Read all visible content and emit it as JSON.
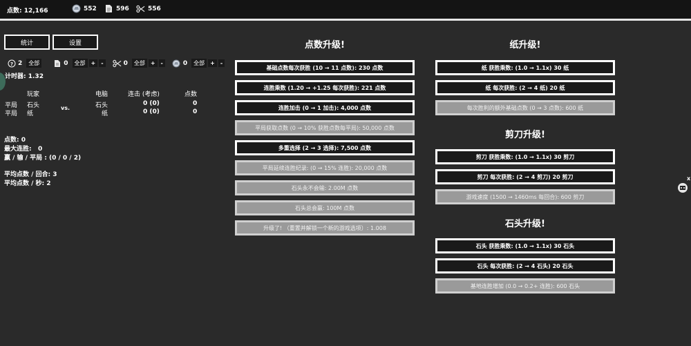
{
  "topbar": {
    "points_label": "点数: 12,166",
    "rock_count": "552",
    "paper_count": "596",
    "scissors_count": "556"
  },
  "buttons": {
    "stats": "统计",
    "settings": "设置"
  },
  "choices": [
    {
      "icon": "help-circle-icon",
      "count": "2",
      "all": "全部",
      "plus": "",
      "minus": ""
    },
    {
      "icon": "paper-icon",
      "count": "0",
      "all": "全部",
      "plus": "+",
      "minus": "-"
    },
    {
      "icon": "scissors-icon",
      "count": "0",
      "all": "全部",
      "plus": "+",
      "minus": "-"
    },
    {
      "icon": "rock-icon",
      "count": "0",
      "all": "全部",
      "plus": "+",
      "minus": "-"
    }
  ],
  "timer": {
    "label": "计时器:",
    "value": "1.32"
  },
  "table": {
    "header_player": "玩家",
    "header_computer": "电脑",
    "header_streak": "连击 (考虑)",
    "header_points": "点数",
    "vs": "vs.",
    "rows": [
      {
        "result": "平局",
        "player": "石头",
        "computer": "石头",
        "streak": "0 (0)",
        "points": "0"
      },
      {
        "result": "平局",
        "player": "纸",
        "computer": "纸",
        "streak": "0 (0)",
        "points": "0"
      }
    ]
  },
  "stats": {
    "points": "点数: 0",
    "max_streak": "最大连胜:   0",
    "wld": "赢 / 输 / 平局 : (0 / 0 / 2)",
    "avg_round": "平均点数 / 回合: 3",
    "avg_sec": "平均点数 / 秒: 2"
  },
  "points_upgrades": {
    "title": "点数升级!",
    "items": [
      {
        "label": "基础点数每次获胜 (10 → 11 点数): 230 点数",
        "state": "dark"
      },
      {
        "label": "连胜乘数 (1.20 → +1.25 每次获胜): 221 点数",
        "state": "dark"
      },
      {
        "label": "连胜加击 (0 → 1 加击): 4,000 点数",
        "state": "dark"
      },
      {
        "label": "平局获取点数 (0 → 10% 获胜点数每平局): 50,000 点数",
        "state": "gray"
      },
      {
        "label": "多重选择 (2 → 3 选择): 7,500 点数",
        "state": "dark"
      },
      {
        "label": "平局延续连胜纪录: (0 → 15% 连胜): 20,000 点数",
        "state": "gray"
      },
      {
        "label": "石头永不会输: 2.00M 点数",
        "state": "gray"
      },
      {
        "label": "石头总会赢: 100M 点数",
        "state": "gray"
      },
      {
        "label": "升级了! （重置并解锁一个新的游戏选项）: 1.008",
        "state": "gray"
      }
    ]
  },
  "paper_upgrades": {
    "title": "纸升级!",
    "items": [
      {
        "label": "纸 获胜乘数: (1.0 → 1.1x) 30 纸",
        "state": "dark"
      },
      {
        "label": "纸 每次获胜: (2 → 4 纸) 20 纸",
        "state": "dark"
      },
      {
        "label": "每次胜利的额外基础点数 (0 → 3 点数): 600 纸",
        "state": "gray"
      }
    ]
  },
  "scissors_upgrades": {
    "title": "剪刀升级!",
    "items": [
      {
        "label": "剪刀 获胜乘数: (1.0 → 1.1x) 30 剪刀",
        "state": "dark"
      },
      {
        "label": "剪刀 每次获胜: (2 → 4 剪刀) 20 剪刀",
        "state": "dark"
      },
      {
        "label": "游戏速度 (1500 → 1460ms 每回合): 600 剪刀",
        "state": "gray"
      }
    ]
  },
  "rock_upgrades": {
    "title": "石头升级!",
    "items": [
      {
        "label": "石头 获胜乘数: (1.0 → 1.1x) 30 石头",
        "state": "dark"
      },
      {
        "label": "石头 每次获胜: (2 → 4 石头) 20 石头",
        "state": "dark"
      },
      {
        "label": "基地连胜增加 (0.0 → 0.2+ 连胜): 600 石头",
        "state": "gray"
      }
    ]
  },
  "colors": {
    "background": "#2a2a2a",
    "topbar": "#141414",
    "button_dark": "#1a1a1a",
    "button_locked": "#9a9a9a",
    "border": "#ffffff"
  },
  "misc": {
    "close": "x"
  }
}
